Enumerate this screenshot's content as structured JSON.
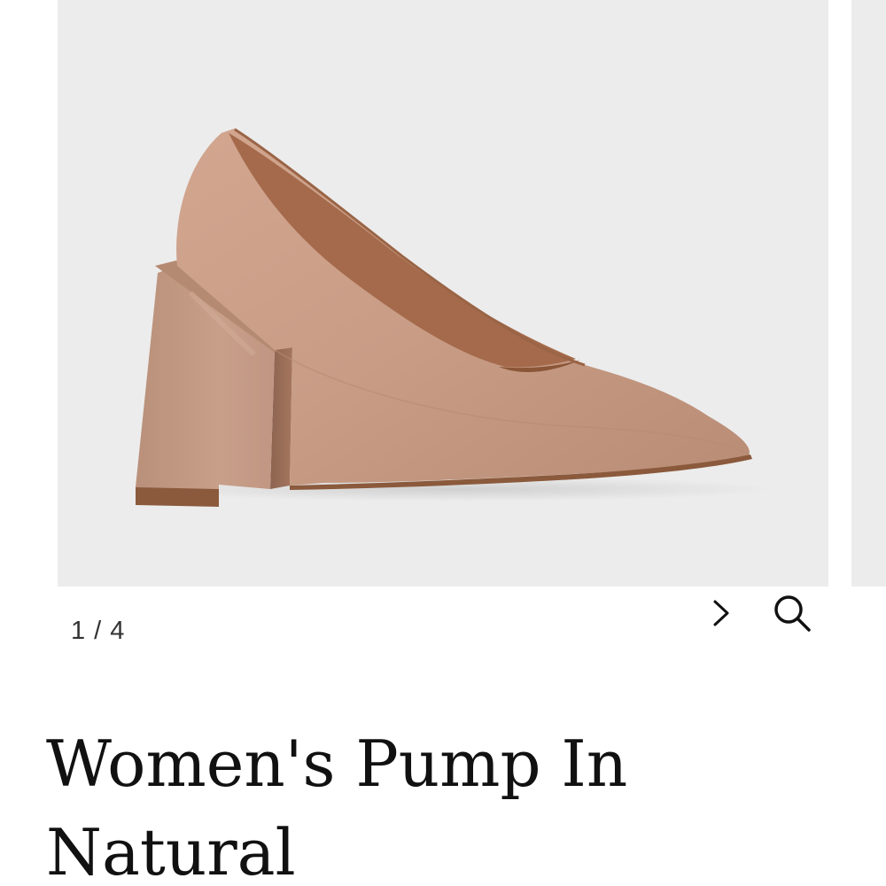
{
  "gallery": {
    "image_alt": "Women's Pump In Natural",
    "current_slide": 1,
    "total_slides": 4,
    "counter_text": "1 / 4",
    "background_color": "#ececec",
    "shoe_color": "#c99d86",
    "sole_color": "#8b5a3c"
  },
  "controls": {
    "next_icon": "chevron-right-icon",
    "zoom_icon": "magnifier-icon"
  },
  "product": {
    "title": "Women's Pump In Natural"
  }
}
